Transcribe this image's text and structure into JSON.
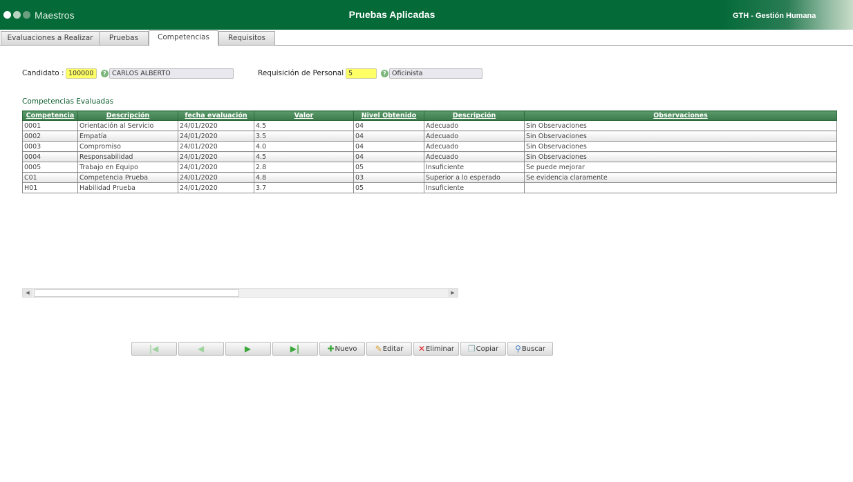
{
  "header": {
    "brand": "Maestros",
    "title": "Pruebas Aplicadas",
    "app": "GTH - Gestión Humana"
  },
  "tabs": [
    {
      "label": "Evaluaciones a Realizar"
    },
    {
      "label": "Pruebas"
    },
    {
      "label": "Competencias",
      "active": true
    },
    {
      "label": "Requisitos"
    }
  ],
  "form": {
    "candidato_label": "Candidato :",
    "candidato_code": "100000",
    "candidato_name": "CARLOS ALBERTO",
    "requisicion_label": "Requisición de Personal :",
    "requisicion_code": "5",
    "requisicion_name": "Oficinista"
  },
  "section_title": "Competencias Evaluadas",
  "table": {
    "headers": [
      "Competencia",
      "Descripción",
      "fecha evaluación",
      "Valor",
      "Nivel Obtenido",
      "Descripción",
      "Observaciones"
    ],
    "rows": [
      [
        "0001",
        "Orientación al Servicio",
        "24/01/2020",
        "4.5",
        "04",
        "Adecuado",
        "Sin Observaciones"
      ],
      [
        "0002",
        "Empatía",
        "24/01/2020",
        "3.5",
        "04",
        "Adecuado",
        "Sin Observaciones"
      ],
      [
        "0003",
        "Compromiso",
        "24/01/2020",
        "4.0",
        "04",
        "Adecuado",
        "Sin Observaciones"
      ],
      [
        "0004",
        "Responsabilidad",
        "24/01/2020",
        "4.5",
        "04",
        "Adecuado",
        "Sin Observaciones"
      ],
      [
        "0005",
        "Trabajo en Equipo",
        "24/01/2020",
        "2.8",
        "05",
        "Insuficiente",
        "Se puede mejorar"
      ],
      [
        "C01",
        "Competencia Prueba",
        "24/01/2020",
        "4.8",
        "03",
        "Superior a lo esperado",
        "Se evidencia claramente"
      ],
      [
        "H01",
        "Habilidad Prueba",
        "24/01/2020",
        "3.7",
        "05",
        "Insuficiente",
        ""
      ]
    ]
  },
  "buttons": {
    "nuevo": "Nuevo",
    "editar": "Editar",
    "eliminar": "Eliminar",
    "copiar": "Copiar",
    "buscar": "Buscar"
  }
}
